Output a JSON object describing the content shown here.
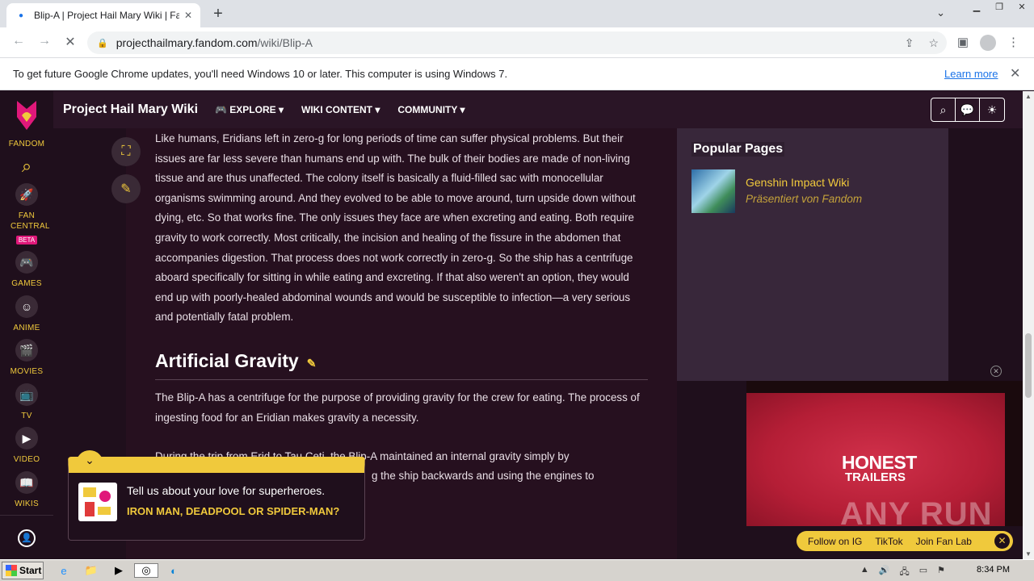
{
  "browser": {
    "tab_title": "Blip-A | Project Hail Mary Wiki | Fandom",
    "url_host": "projecthailmary.fandom.com",
    "url_path": "/wiki/Blip-A",
    "infobar_message": "To get future Google Chrome updates, you'll need Windows 10 or later. This computer is using Windows 7.",
    "infobar_link": "Learn more"
  },
  "rail": {
    "brand": "FANDOM",
    "items": [
      {
        "label": "FAN CENTRAL",
        "badge": "BETA",
        "icon": "rocket-icon"
      },
      {
        "label": "GAMES",
        "icon": "gamepad-icon"
      },
      {
        "label": "ANIME",
        "icon": "anime-icon"
      },
      {
        "label": "MOVIES",
        "icon": "clapper-icon"
      },
      {
        "label": "TV",
        "icon": "tv-icon"
      },
      {
        "label": "VIDEO",
        "icon": "play-icon"
      },
      {
        "label": "WIKIS",
        "icon": "book-icon"
      }
    ]
  },
  "wiki": {
    "name": "Project Hail Mary Wiki",
    "nav": [
      "EXPLORE",
      "WIKI CONTENT",
      "COMMUNITY"
    ]
  },
  "article": {
    "para1": "Like humans, Eridians left in zero-g for long periods of time can suffer physical problems. But their issues are far less severe than humans end up with. The bulk of their bodies are made of non-living tissue and are thus unaffected. The colony itself is basically a fluid-filled sac with monocellular organisms swimming around. And they evolved to be able to move around, turn upside down without dying, etc. So that works fine. The only issues they face are when excreting and eating. Both require gravity to work correctly. Most critically, the incision and healing of the fissure in the abdomen that accompanies digestion. That process does not work correctly in zero-g. So the ship has a centrifuge aboard specifically for sitting in while eating and excreting. If that also weren't an option, they would end up with poorly-healed abdominal wounds and would be susceptible to infection—a very serious and potentially fatal problem.",
    "heading": "Artificial Gravity",
    "para2": "The Blip-A has a centrifuge for the purpose of providing gravity for the crew for eating. The process of ingesting food for an Eridian makes gravity a necessity.",
    "para3a": "During the trip from Erid to Tau Ceti, the Blip-A maintained an internal gravity simply by",
    "para3b": "g the ship backwards and using the engines to"
  },
  "sidebar": {
    "popular_heading": "Popular Pages",
    "item_title": "Genshin Impact Wiki",
    "item_sub": "Präsentiert von Fandom"
  },
  "video": {
    "line1": "HONEST",
    "line2": "TRAILERS",
    "watermark": "ANY RUN",
    "follow": [
      "Follow on IG",
      "TikTok",
      "Join Fan Lab"
    ]
  },
  "poll": {
    "question": "Tell us about your love for superheroes.",
    "answer": "IRON MAN, DEADPOOL OR SPIDER-MAN?"
  },
  "taskbar": {
    "start": "Start",
    "time": "8:34 PM"
  },
  "colors": {
    "accent": "#f0c93c",
    "background": "#1f0f1c",
    "fandom_pink": "#e0187a"
  }
}
